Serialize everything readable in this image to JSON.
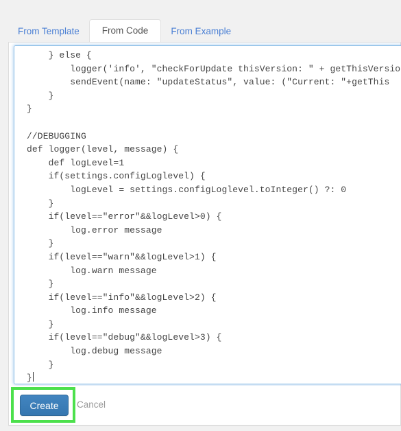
{
  "tabs": [
    {
      "label": "From Template",
      "active": false
    },
    {
      "label": "From Code",
      "active": true
    },
    {
      "label": "From Example",
      "active": false
    }
  ],
  "editor": {
    "language": "groovy",
    "caret_line": 24,
    "code": "    } else {\n        logger('info', \"checkForUpdate thisVersion: \" + getThisVersion\n        sendEvent(name: \"updateStatus\", value: (\"Current: \"+getThis\n    }\n}\n\n//DEBUGGING\ndef logger(level, message) {\n    def logLevel=1\n    if(settings.configLoglevel) {\n        logLevel = settings.configLoglevel.toInteger() ?: 0\n    }\n    if(level==\"error\"&&logLevel>0) {\n        log.error message\n    }\n    if(level==\"warn\"&&logLevel>1) {\n        log.warn message\n    }\n    if(level==\"info\"&&logLevel>2) {\n        log.info message\n    }\n    if(level==\"debug\"&&logLevel>3) {\n        log.debug message\n    }\n}"
  },
  "footer": {
    "create_label": "Create",
    "cancel_label": "Cancel"
  },
  "colors": {
    "page_background": "#f1f1f1",
    "panel_background": "#ffffff",
    "tab_link": "#4a7fd4",
    "tab_active_text": "#555555",
    "editor_focus_border": "#8fc0e8",
    "code_text": "#444444",
    "create_button": "#3b7cb8",
    "create_button_text": "#ffffff",
    "cancel_text": "#999999",
    "highlight_box": "#4ce04c"
  }
}
